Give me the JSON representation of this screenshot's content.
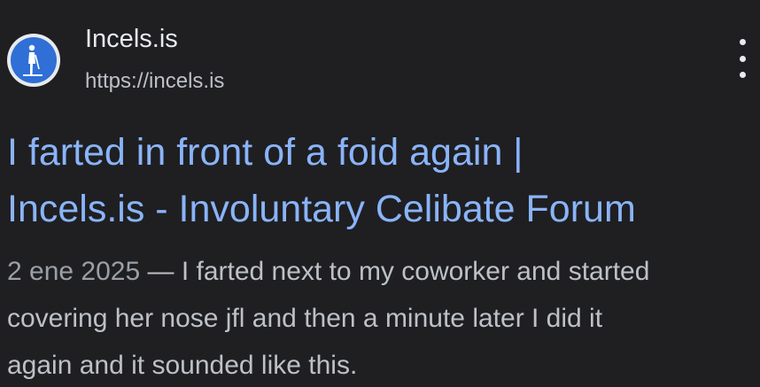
{
  "result": {
    "favicon_icon": "person-cane-icon",
    "site_name": "Incels.is",
    "site_url": "https://incels.is",
    "more_icon": "more-vert-icon",
    "title_line1": "I farted in front of a foid again |",
    "title_line2": "Incels.is - Involuntary Celibate Forum",
    "snippet_date": "2 ene 2025",
    "snippet_sep": " — ",
    "snippet_line1_text": "I farted next to my coworker and started",
    "snippet_line2": "covering her nose jfl and then a minute later I did it",
    "snippet_line3": "again and it sounded like this."
  },
  "colors": {
    "background": "#1f1f22",
    "title_link": "#8ab4f8",
    "site_name": "#e8eaed",
    "url": "#bdc1c6",
    "snippet": "#bdc1c6",
    "favicon_bg": "#2f6fd6"
  }
}
